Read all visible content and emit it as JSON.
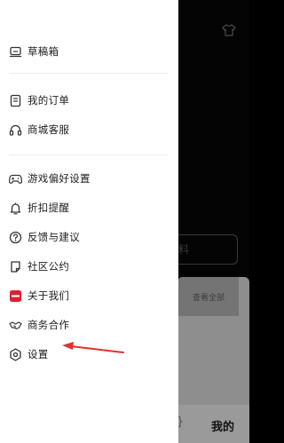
{
  "menu": {
    "draft_box": "草稿箱",
    "my_orders": "我的订单",
    "customer_service": "商城客服",
    "game_prefs": "游戏偏好设置",
    "discount_reminder": "折扣提醒",
    "feedback": "反馈与建议",
    "community_rules": "社区公约",
    "about_us": "关于我们",
    "business": "商务合作",
    "settings": "设置"
  },
  "background": {
    "view_all": "查看全部",
    "profile_button_fragment": "料",
    "tab_me": "我的",
    "tab_partial": "}"
  },
  "colors": {
    "about_us_icon": "#e0212b",
    "annotation_arrow": "#e3312d"
  }
}
